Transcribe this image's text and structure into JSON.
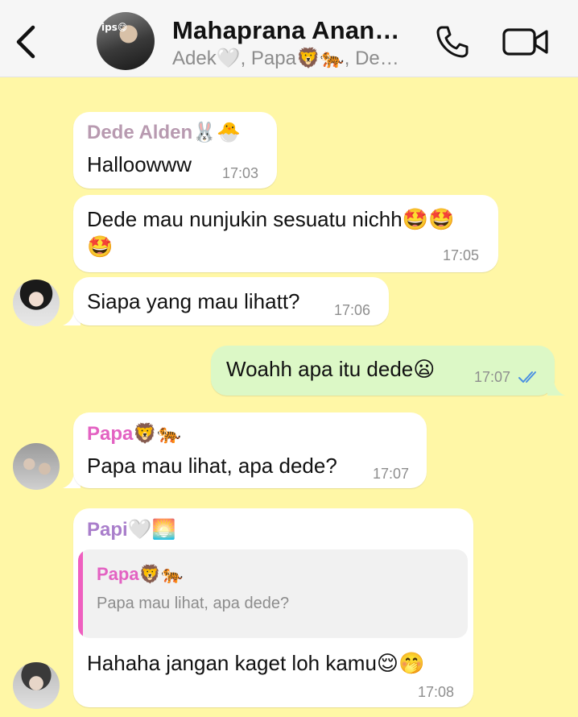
{
  "header": {
    "title": "Mahaprana Anan…",
    "subtitle": "Adek🤍, Papa🦁🐅, De…",
    "avatar_tag": "ips😋"
  },
  "messages": [
    {
      "sender": "Dede Alden🐰🐣",
      "text": "Halloowww",
      "time": "17:03"
    },
    {
      "text_line1": "Dede mau nunjukin sesuatu nichh🤩🤩",
      "text_line2": "🤩",
      "time": "17:05"
    },
    {
      "text": "Siapa yang mau lihatt?",
      "time": "17:06"
    },
    {
      "text": "Woahh apa itu dede😦",
      "time": "17:07",
      "status": "read"
    },
    {
      "sender": "Papa🦁🐅",
      "text": "Papa mau lihat, apa dede?",
      "time": "17:07"
    },
    {
      "sender": "Papi🤍🌅",
      "reply": {
        "sender": "Papa🦁🐅",
        "text": "Papa mau lihat, apa dede?"
      },
      "text": "Hahaha jangan kaget loh kamu😌🤭",
      "time": "17:08"
    }
  ],
  "colors": {
    "background": "#fff7a6",
    "incoming": "#ffffff",
    "outgoing": "#dcf8c6",
    "sender_dede": "#b89ab0",
    "sender_papa": "#e362c2",
    "sender_papi": "#a97ecb",
    "read_ticks": "#4a90e2"
  },
  "icons": [
    "back-chevron-icon",
    "phone-icon",
    "video-camera-icon",
    "read-receipt-icon"
  ]
}
